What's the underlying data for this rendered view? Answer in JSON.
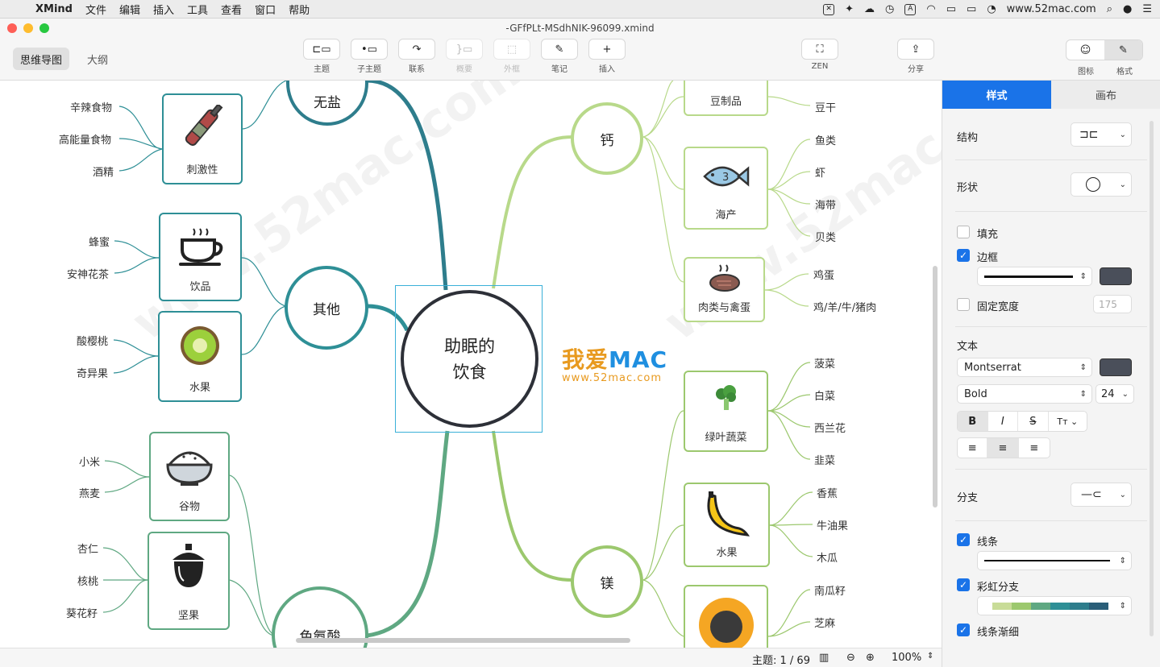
{
  "menubar": {
    "app_name": "XMind",
    "menus": [
      "文件",
      "编辑",
      "插入",
      "工具",
      "查看",
      "窗口",
      "帮助"
    ],
    "site": "www.52mac.com"
  },
  "window": {
    "title": "-GFfPLt-MSdhNIK-96099.xmind",
    "view_tabs": [
      "思维导图",
      "大纲"
    ]
  },
  "toolbar": {
    "buttons": [
      "主题",
      "子主题",
      "联系",
      "概要",
      "外框",
      "笔记",
      "插入"
    ],
    "zen": "ZEN",
    "share": "分享",
    "icon_tab": "图标",
    "format_tab": "格式"
  },
  "map": {
    "central": [
      "助眠的",
      "饮食"
    ],
    "topics": {
      "other": "其他",
      "calcium": "钙",
      "magnesium": "镁",
      "top_left": "无盐",
      "bottom_left": "色氨酸"
    },
    "cards": {
      "spicy": "刺激性",
      "drink": "饮品",
      "fruit_left": "水果",
      "grain": "谷物",
      "nut": "坚果",
      "soy": "豆制品",
      "seafood": "海产",
      "meat": "肉类与禽蛋",
      "greens": "绿叶蔬菜",
      "fruit_right": "水果"
    },
    "leaves": {
      "spicy": [
        "辛辣食物",
        "高能量食物",
        "酒精"
      ],
      "drink": [
        "蜂蜜",
        "安神花茶"
      ],
      "fruit_left": [
        "酸樱桃",
        "奇异果"
      ],
      "grain": [
        "小米",
        "燕麦"
      ],
      "nut": [
        "杏仁",
        "核桃",
        "葵花籽"
      ],
      "soy": [
        "豆干"
      ],
      "seafood": [
        "鱼类",
        "虾",
        "海带",
        "贝类"
      ],
      "meat": [
        "鸡蛋",
        "鸡/羊/牛/猪肉"
      ],
      "greens": [
        "菠菜",
        "白菜",
        "西兰花",
        "韭菜"
      ],
      "fruit_right": [
        "香蕉",
        "牛油果",
        "木瓜"
      ],
      "seeds": [
        "南瓜籽",
        "芝麻"
      ]
    }
  },
  "brand": {
    "text_orange": "我爱",
    "text_blue": "MAC",
    "url": "www.52mac.com"
  },
  "watermark": "www.52mac.com",
  "status": {
    "topic_count": "主题: 1 / 69",
    "zoom": "100%"
  },
  "panel": {
    "tabs": [
      "样式",
      "画布"
    ],
    "structure": "结构",
    "shape": "形状",
    "fill": "填充",
    "border": "边框",
    "fixed_width": "固定宽度",
    "fixed_width_value": "175",
    "text": "文本",
    "font": "Montserrat",
    "weight": "Bold",
    "size": "24",
    "branch": "分支",
    "line": "线条",
    "rainbow": "彩虹分支",
    "taper": "线条渐细",
    "colors": {
      "accent": "#1a73e8",
      "swatch": "#4a4f5a"
    }
  }
}
